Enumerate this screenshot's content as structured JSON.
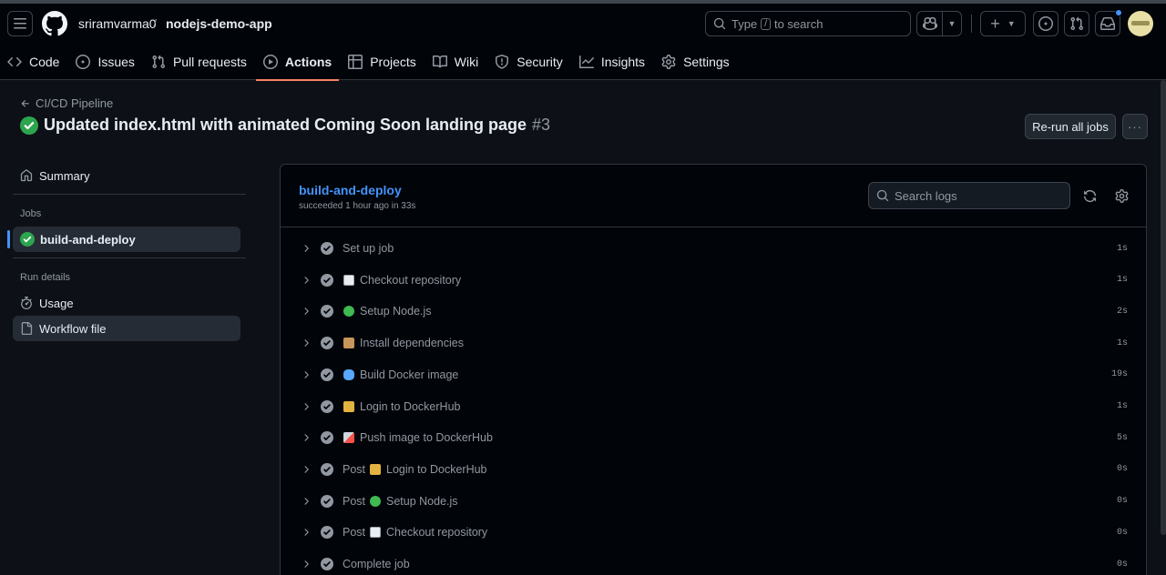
{
  "header": {
    "owner": "sriramvarma0",
    "separator": "/",
    "repo": "nodejs-demo-app",
    "search_prefix": "Type",
    "search_key": "/",
    "search_suffix": "to search"
  },
  "repo_nav": {
    "tabs": [
      {
        "label": "Code",
        "icon": "code-icon"
      },
      {
        "label": "Issues",
        "icon": "issue-opened-icon"
      },
      {
        "label": "Pull requests",
        "icon": "git-pull-request-icon"
      },
      {
        "label": "Actions",
        "icon": "play-icon",
        "active": true
      },
      {
        "label": "Projects",
        "icon": "table-icon"
      },
      {
        "label": "Wiki",
        "icon": "book-icon"
      },
      {
        "label": "Security",
        "icon": "shield-icon"
      },
      {
        "label": "Insights",
        "icon": "graph-icon"
      },
      {
        "label": "Settings",
        "icon": "gear-icon"
      }
    ]
  },
  "run": {
    "workflow": "CI/CD Pipeline",
    "title": "Updated index.html with animated Coming Soon landing page",
    "number": "#3",
    "rerun_label": "Re-run all jobs",
    "more_label": "···"
  },
  "sidebar": {
    "summary": "Summary",
    "jobs_heading": "Jobs",
    "job": "build-and-deploy",
    "run_details_heading": "Run details",
    "usage": "Usage",
    "workflow_file": "Workflow file"
  },
  "job_panel": {
    "name": "build-and-deploy",
    "meta": "succeeded 1 hour ago in 33s",
    "search_placeholder": "Search logs",
    "steps": [
      {
        "prefix": "",
        "emoji": "",
        "name": "Set up job",
        "duration": "1s"
      },
      {
        "prefix": "",
        "emoji": "page-icon",
        "name": "Checkout repository",
        "duration": "1s"
      },
      {
        "prefix": "",
        "emoji": "green-circle-icon",
        "name": "Setup Node.js",
        "duration": "2s"
      },
      {
        "prefix": "",
        "emoji": "package-icon",
        "name": "Install dependencies",
        "duration": "1s"
      },
      {
        "prefix": "",
        "emoji": "whale-icon",
        "name": "Build Docker image",
        "duration": "19s"
      },
      {
        "prefix": "",
        "emoji": "lock-key-icon",
        "name": "Login to DockerHub",
        "duration": "1s"
      },
      {
        "prefix": "",
        "emoji": "rocket-icon",
        "name": "Push image to DockerHub",
        "duration": "5s"
      },
      {
        "prefix": "Post",
        "emoji": "lock-key-icon",
        "name": "Login to DockerHub",
        "duration": "0s"
      },
      {
        "prefix": "Post",
        "emoji": "green-circle-icon",
        "name": "Setup Node.js",
        "duration": "0s"
      },
      {
        "prefix": "Post",
        "emoji": "page-icon",
        "name": "Checkout repository",
        "duration": "0s"
      },
      {
        "prefix": "",
        "emoji": "",
        "name": "Complete job",
        "duration": "0s"
      }
    ]
  },
  "colors": {
    "success": "#2da44e",
    "link": "#4493f8",
    "active_tab": "#f78166"
  }
}
